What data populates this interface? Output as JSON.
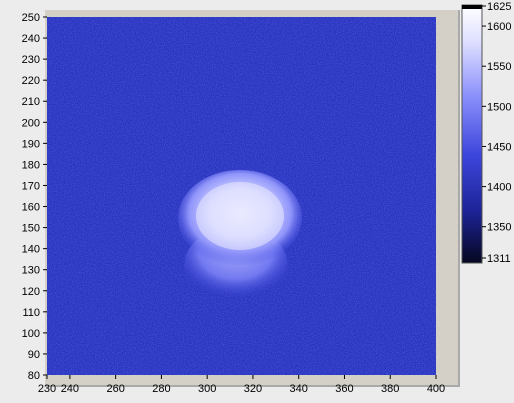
{
  "image_plot": {
    "x_axis": {
      "range": [
        230,
        400
      ],
      "ticks": [
        230,
        240,
        260,
        280,
        300,
        320,
        340,
        360,
        380,
        400
      ]
    },
    "y_axis": {
      "range": [
        80,
        250
      ],
      "ticks": [
        80,
        90,
        100,
        110,
        120,
        130,
        140,
        150,
        160,
        170,
        180,
        190,
        200,
        210,
        220,
        230,
        240,
        250
      ]
    },
    "colors": {
      "background": "#2a35c0",
      "noise_dark": "#141a8a",
      "blob_core": "#e6e8ff",
      "blob_mid": "#b7baff",
      "blob_edge": "#6b70f2"
    }
  },
  "color_scale": {
    "range": [
      1311,
      1625
    ],
    "labels": [
      "1625",
      "1600",
      "1550",
      "1500",
      "1450",
      "1400",
      "1350",
      "1311"
    ],
    "gradient": [
      "#ffffff",
      "#b4b7ff",
      "#5a62f1",
      "#2d36c9",
      "#1c2294",
      "#070a2d"
    ]
  }
}
